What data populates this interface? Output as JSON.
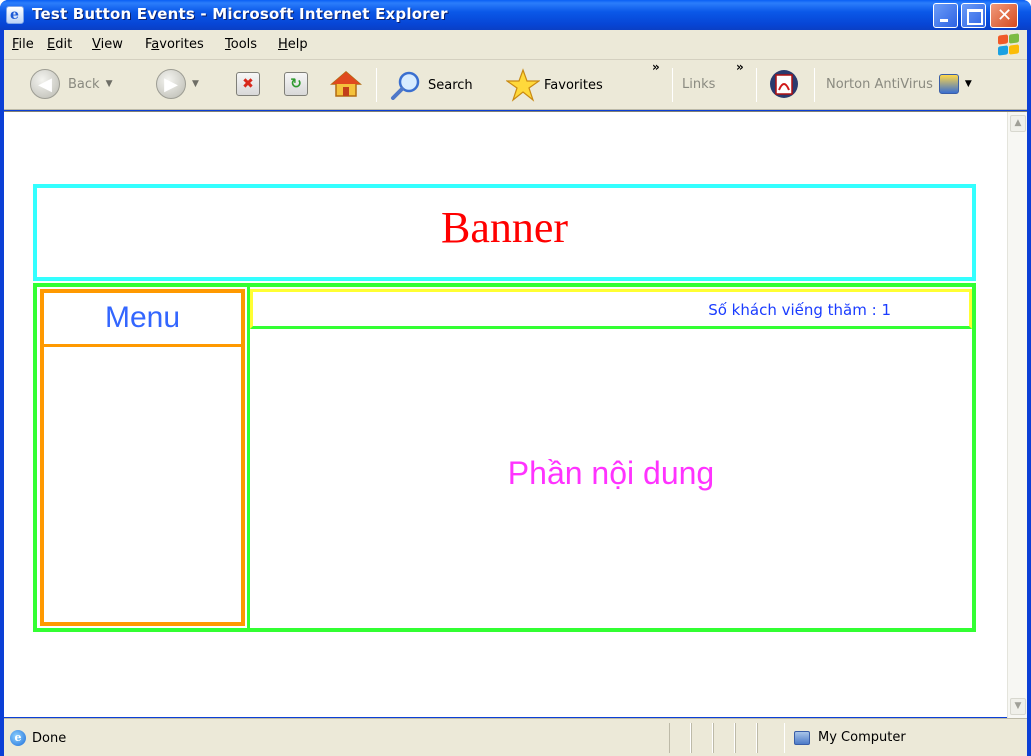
{
  "window": {
    "title": "Test Button Events - Microsoft Internet Explorer"
  },
  "menubar": {
    "items": [
      {
        "label_underlined": "F",
        "label_rest": "ile"
      },
      {
        "label_underlined": "E",
        "label_rest": "dit"
      },
      {
        "label_underlined": "V",
        "label_rest": "iew"
      },
      {
        "label_before": "F",
        "label_underlined": "a",
        "label_rest": "vorites"
      },
      {
        "label_underlined": "T",
        "label_rest": "ools"
      },
      {
        "label_underlined": "H",
        "label_rest": "elp"
      }
    ]
  },
  "toolbar": {
    "back_label": "Back",
    "search_label": "Search",
    "favorites_label": "Favorites",
    "links_label": "Links",
    "norton_label": "Norton AntiVirus",
    "chevron": "»"
  },
  "page": {
    "banner": "Banner",
    "menu_title": "Menu",
    "visitor_text": "Số khách viếng thăm : 1",
    "content_text": "Phần nội dung"
  },
  "status": {
    "left_text": "Done",
    "zone_text": "My Computer"
  },
  "colors": {
    "banner_border": "#33ffff",
    "banner_text": "#ff0000",
    "main_border": "#33ff33",
    "menu_border": "#ff9900",
    "menu_text": "#3366ff",
    "visitor_border": "#ffff33",
    "visitor_text": "#1a3cff",
    "content_text": "#ff33ff"
  },
  "icons": [
    "ie-icon",
    "minimize-icon",
    "maximize-icon",
    "close-icon",
    "windows-logo-icon",
    "back-arrow-icon",
    "forward-arrow-icon",
    "stop-icon",
    "refresh-icon",
    "home-icon",
    "search-icon",
    "favorites-star-icon",
    "pdf-icon",
    "norton-icon",
    "computer-icon"
  ]
}
